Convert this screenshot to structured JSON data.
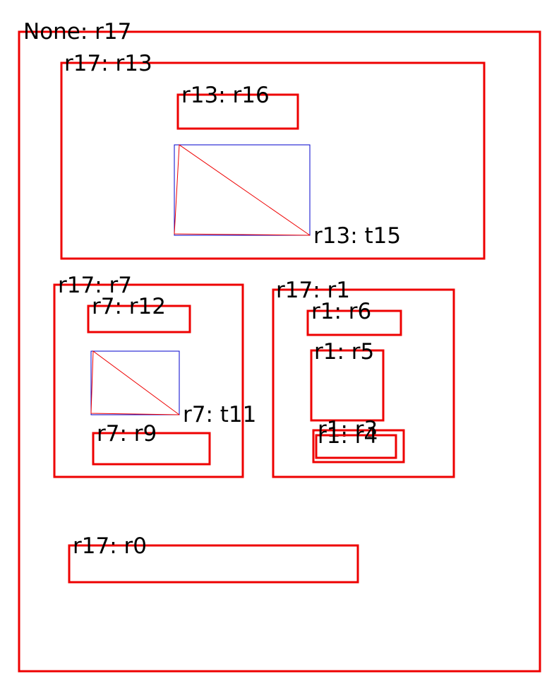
{
  "diagram": {
    "region_color": "#ee0000",
    "text_box_color": "#0000cc",
    "text_diag_color": "#ee0000",
    "regions": [
      {
        "id": "r17",
        "label": "None: r17"
      },
      {
        "id": "r13",
        "label": "r17: r13"
      },
      {
        "id": "r16",
        "label": "r13: r16"
      },
      {
        "id": "r7",
        "label": "r17: r7"
      },
      {
        "id": "r12",
        "label": "r7: r12"
      },
      {
        "id": "r9",
        "label": "r7: r9"
      },
      {
        "id": "r1",
        "label": "r17: r1"
      },
      {
        "id": "r6",
        "label": "r1: r6"
      },
      {
        "id": "r5",
        "label": "r1: r5"
      },
      {
        "id": "r3",
        "label": "r1: r3"
      },
      {
        "id": "r4",
        "label": "r1: r4"
      },
      {
        "id": "r0",
        "label": "r17: r0"
      }
    ],
    "texts": [
      {
        "id": "t15",
        "label": "r13: t15"
      },
      {
        "id": "t11",
        "label": "r7: t11"
      }
    ]
  }
}
